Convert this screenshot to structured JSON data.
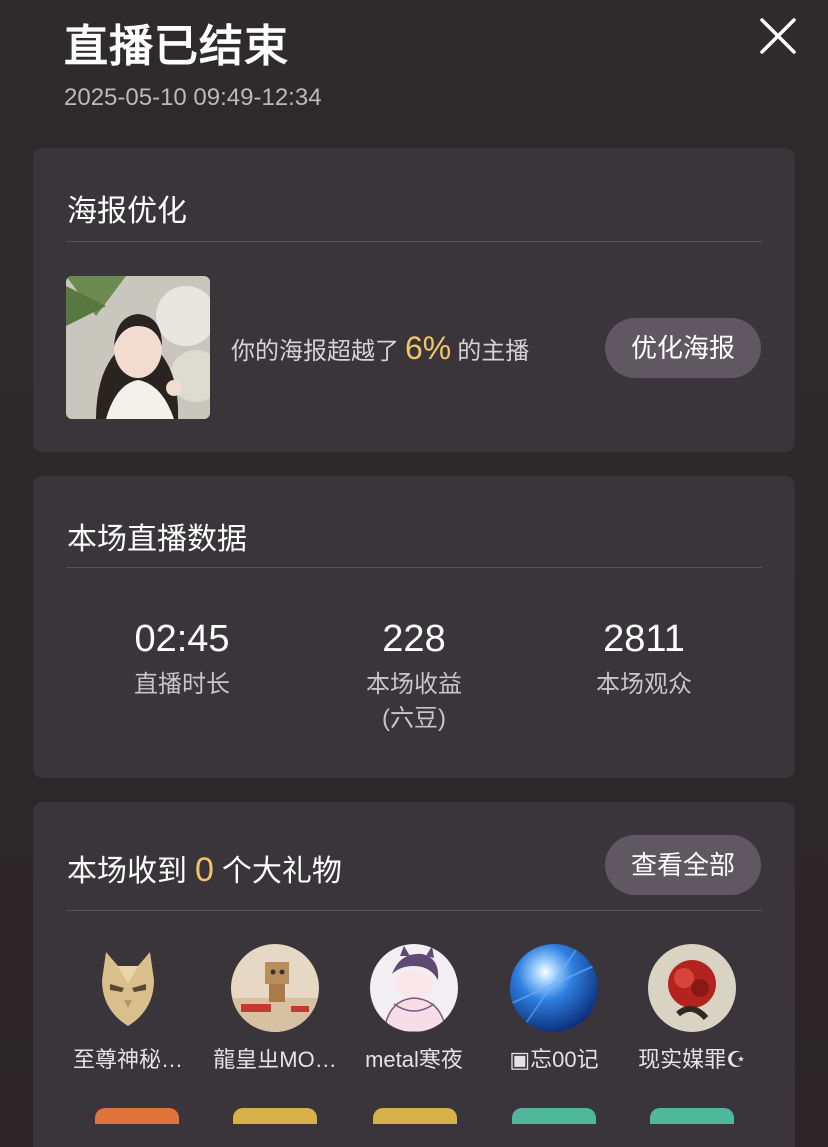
{
  "header": {
    "title": "直播已结束",
    "subtitle": "2025-05-10 09:49-12:34"
  },
  "poster": {
    "title": "海报优化",
    "text_prefix": "你的海报超越了",
    "percent": "6%",
    "text_suffix": "的主播",
    "button_label": "优化海报"
  },
  "stats": {
    "title": "本场直播数据",
    "items": [
      {
        "value": "02:45",
        "label": "直播时长",
        "unit": ""
      },
      {
        "value": "228",
        "label": "本场收益",
        "unit": "(六豆)"
      },
      {
        "value": "2811",
        "label": "本场观众",
        "unit": ""
      }
    ]
  },
  "gifts": {
    "title_prefix": "本场收到",
    "count": "0",
    "title_suffix": "个大礼物",
    "view_all_label": "查看全部",
    "gifters": [
      {
        "name": "至尊神秘…",
        "avatar": "golden-mask"
      },
      {
        "name": "龍皇ㄓMO…",
        "avatar": "danbo-photo"
      },
      {
        "name": "metal寒夜",
        "avatar": "anime-drawing"
      },
      {
        "name": "▣忘00记",
        "avatar": "blue-light"
      },
      {
        "name": "现实媒罪☪",
        "avatar": "red-flower"
      }
    ]
  },
  "colors": {
    "accent": "#f2c56a",
    "card_bg": "#39353a",
    "button_bg": "#5f5860"
  }
}
